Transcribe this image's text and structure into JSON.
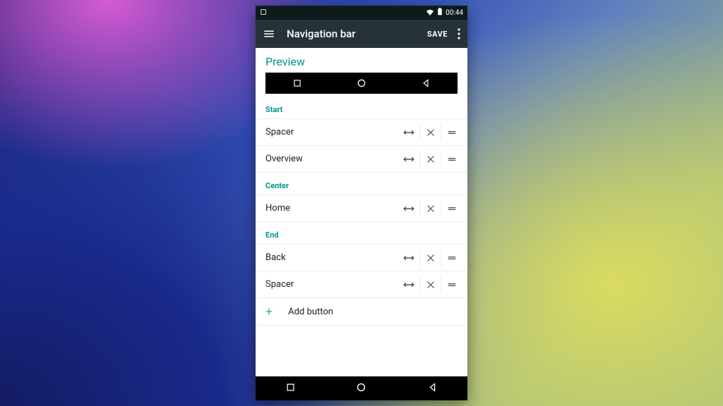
{
  "status_bar": {
    "time": "00:44"
  },
  "app_bar": {
    "title": "Navigation bar",
    "save_label": "SAVE"
  },
  "preview": {
    "heading": "Preview"
  },
  "sections": {
    "start": {
      "label": "Start",
      "items": [
        {
          "label": "Spacer"
        },
        {
          "label": "Overview"
        }
      ]
    },
    "center": {
      "label": "Center",
      "items": [
        {
          "label": "Home"
        }
      ]
    },
    "end": {
      "label": "End",
      "items": [
        {
          "label": "Back"
        },
        {
          "label": "Spacer"
        }
      ]
    }
  },
  "add_button_label": "Add button",
  "accent": "#009688"
}
